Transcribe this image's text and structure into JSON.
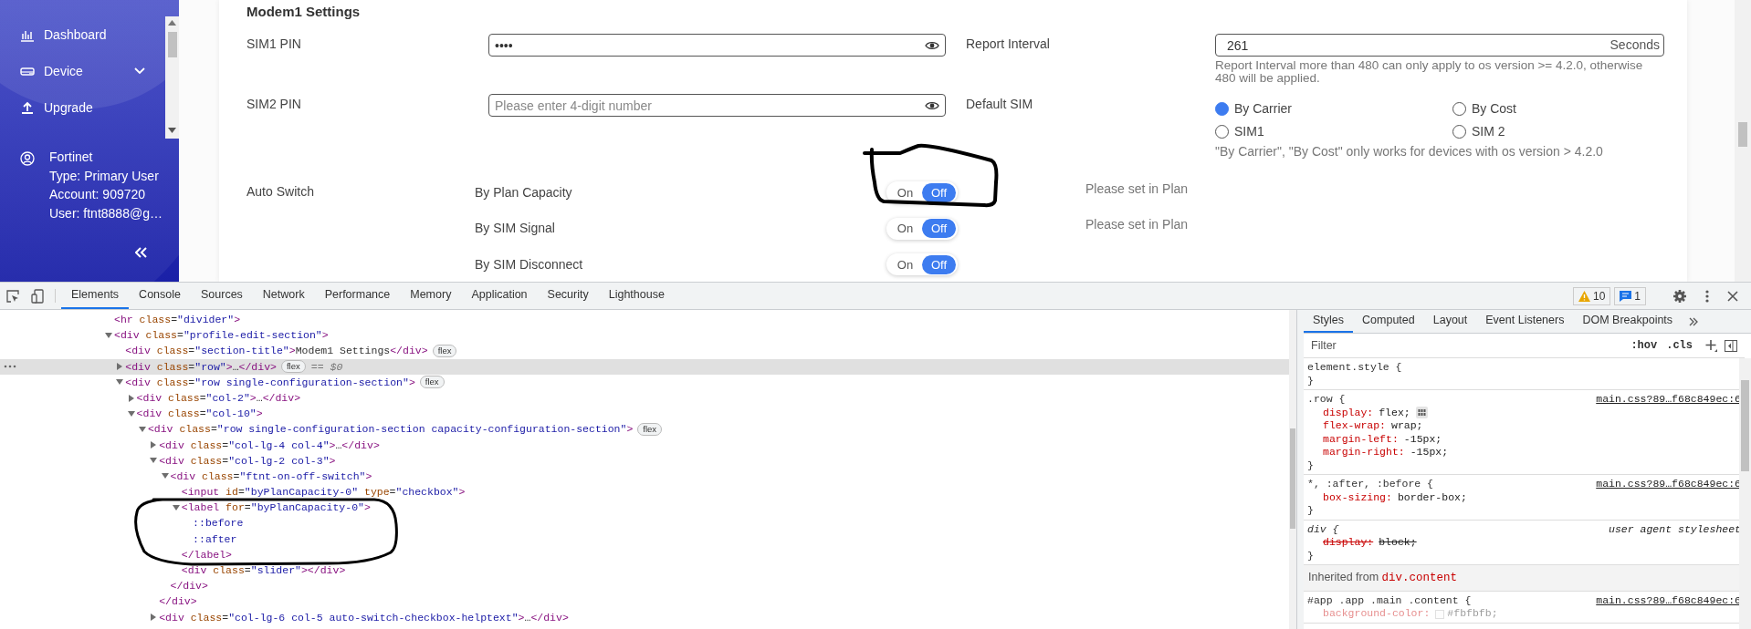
{
  "sidebar": {
    "items": [
      {
        "label": "Dashboard",
        "kind": "link"
      },
      {
        "label": "Device",
        "kind": "group",
        "expanded": false
      },
      {
        "label": "Upgrade",
        "kind": "link"
      }
    ],
    "user": {
      "name": "Fortinet",
      "lines": [
        "Type: Primary User",
        "Account: 909720",
        "User: ftnt8888@g…"
      ]
    }
  },
  "settings": {
    "title": "Modem1 Settings",
    "pins": [
      {
        "label": "SIM1 PIN",
        "value": "••••"
      },
      {
        "label": "SIM2 PIN",
        "placeholder": "Please enter 4-digit number"
      }
    ],
    "report_interval": {
      "label": "Report Interval",
      "value": "261",
      "unit": "Seconds",
      "hint": "Report Interval more than 480 can only apply to os version >= 4.2.0, otherwise 480 will be applied."
    },
    "default_sim": {
      "label": "Default SIM",
      "options": [
        {
          "label": "By Carrier",
          "selected": true
        },
        {
          "label": "By Cost",
          "selected": false
        },
        {
          "label": "SIM1",
          "selected": false
        },
        {
          "label": "SIM 2",
          "selected": false
        }
      ],
      "note": "\"By Carrier\", \"By Cost\" only works for devices with os version > 4.2.0"
    },
    "auto_switch": {
      "label": "Auto Switch",
      "options": [
        {
          "name": "By Plan Capacity",
          "on_label": "On",
          "off_label": "Off",
          "on": false,
          "help": "Please set in Plan"
        },
        {
          "name": "By SIM Signal",
          "on_label": "On",
          "off_label": "Off",
          "on": false,
          "help": "Please set in Plan"
        },
        {
          "name": "By SIM Disconnect",
          "on_label": "On",
          "off_label": "Off",
          "on": false
        }
      ]
    }
  },
  "devtools": {
    "tabs": [
      {
        "label": "Elements",
        "selected": true
      },
      {
        "label": "Console",
        "selected": false
      },
      {
        "label": "Sources",
        "selected": false
      },
      {
        "label": "Network",
        "selected": false
      },
      {
        "label": "Performance",
        "selected": false
      },
      {
        "label": "Memory",
        "selected": false
      },
      {
        "label": "Application",
        "selected": false
      },
      {
        "label": "Security",
        "selected": false
      },
      {
        "label": "Lighthouse",
        "selected": false
      }
    ],
    "warnings": "10",
    "messages": "1",
    "dom_tree": [
      {
        "kind": "element",
        "text": "<hr class=\"divider\">",
        "selected": false
      },
      {
        "kind": "element",
        "text": "<div class=\"profile-edit-section\">",
        "expanded": true,
        "selected": false,
        "children": [
          {
            "kind": "element",
            "text": "<div class=\"section-title\">Modem1 Settings</div>",
            "badge": "flex",
            "selected": false
          },
          {
            "kind": "element",
            "text": "<div class=\"row\">…</div>",
            "expanded": false,
            "badge": "flex",
            "selected": true,
            "marker": "== $0"
          },
          {
            "kind": "element",
            "text": "<div class=\"row single-configuration-section\">",
            "expanded": true,
            "badge": "flex",
            "selected": false,
            "children": [
              {
                "kind": "element",
                "text": "<div class=\"col-2\">…</div>",
                "expanded": false,
                "selected": false
              },
              {
                "kind": "element",
                "text": "<div class=\"col-10\">",
                "expanded": true,
                "selected": false,
                "children": [
                  {
                    "kind": "element",
                    "text": "<div class=\"row single-configuration-section capacity-configuration-section\">",
                    "expanded": true,
                    "badge": "flex",
                    "selected": false,
                    "children": [
                      {
                        "kind": "element",
                        "text": "<div class=\"col-lg-4 col-4\">…</div>",
                        "expanded": false,
                        "selected": false
                      },
                      {
                        "kind": "element",
                        "text": "<div class=\"col-lg-2 col-3\">",
                        "expanded": true,
                        "selected": false,
                        "close": "</div>",
                        "children": [
                          {
                            "kind": "element",
                            "text": "<div class=\"ftnt-on-off-switch\">",
                            "expanded": true,
                            "selected": false,
                            "close": "</div>",
                            "children": [
                              {
                                "kind": "element",
                                "text": "<input id=\"byPlanCapacity-0\" type=\"checkbox\">",
                                "selected": false
                              },
                              {
                                "kind": "element",
                                "text": "<label for=\"byPlanCapacity-0\">",
                                "expanded": true,
                                "selected": false,
                                "close": "</label>",
                                "children": [
                                  {
                                    "kind": "pseudo",
                                    "text": "::before",
                                    "selected": false
                                  },
                                  {
                                    "kind": "pseudo",
                                    "text": "::after",
                                    "selected": false
                                  }
                                ]
                              },
                              {
                                "kind": "element",
                                "text": "<div class=\"slider\"></div>",
                                "selected": false
                              }
                            ]
                          }
                        ]
                      },
                      {
                        "kind": "element",
                        "text": "<div class=\"col-lg-6 col-5 auto-switch-checkbox-helptext\">…</div>",
                        "expanded": false,
                        "selected": false
                      }
                    ]
                  }
                ]
              }
            ]
          }
        ]
      }
    ],
    "style_tabs": [
      {
        "label": "Styles",
        "selected": true
      },
      {
        "label": "Computed",
        "selected": false
      },
      {
        "label": "Layout",
        "selected": false
      },
      {
        "label": "Event Listeners",
        "selected": false
      },
      {
        "label": "DOM Breakpoints",
        "selected": false
      }
    ],
    "filter": {
      "placeholder": "Filter"
    },
    "hov": ":hov",
    "cls": ".cls",
    "rules": [
      {
        "kind": "rule",
        "selector": "element.style {",
        "close": "}"
      },
      {
        "kind": "rule",
        "selector": ".row {",
        "source": "main.css?89…f68c849ec:6",
        "properties": [
          {
            "name": "display:",
            "value": "flex;",
            "kind": "flex",
            "struck": false,
            "inactive": false
          },
          {
            "name": "flex-wrap:",
            "value": "wrap;",
            "kind": "plain",
            "struck": false,
            "inactive": false
          },
          {
            "name": "margin-left:",
            "value": "-15px;",
            "kind": "plain",
            "struck": false,
            "inactive": false
          },
          {
            "name": "margin-right:",
            "value": "-15px;",
            "kind": "plain",
            "struck": false,
            "inactive": false
          }
        ],
        "close": "}"
      },
      {
        "kind": "rule",
        "selector": "*, :after, :before {",
        "source": "main.css?89…f68c849ec:6",
        "properties": [
          {
            "name": "box-sizing:",
            "value": "border-box;",
            "kind": "plain",
            "struck": false,
            "inactive": false
          }
        ],
        "close": "}"
      },
      {
        "kind": "agent",
        "selector": "div {",
        "source": "user agent stylesheet",
        "properties": [
          {
            "name": "display:",
            "value": "block;",
            "kind": "plain",
            "struck": true,
            "inactive": false
          }
        ],
        "close": "}"
      },
      {
        "kind": "inherited",
        "text": "Inherited from ",
        "element": "div.content"
      },
      {
        "kind": "rule",
        "selector": "#app .app .main .content {",
        "source": "main.css?89…f68c849ec:6",
        "properties": [
          {
            "name": "background-color:",
            "value": "#fbfbfb;",
            "kind": "color",
            "struck": false,
            "inactive": true
          }
        ]
      }
    ]
  }
}
